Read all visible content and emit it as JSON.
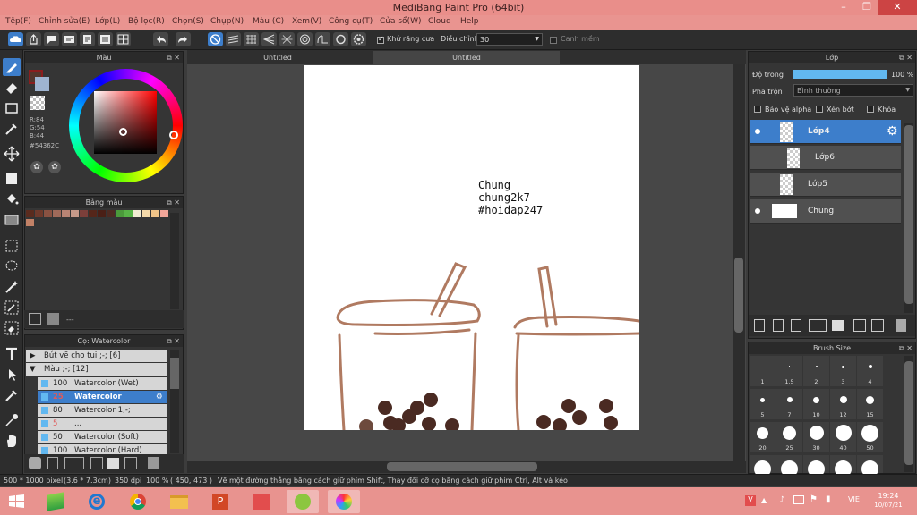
{
  "window": {
    "title": "MediBang Paint Pro (64bit)"
  },
  "menu": [
    "Tệp(F)",
    "Chỉnh sửa(E)",
    "Lớp(L)",
    "Bộ lọc(R)",
    "Chọn(S)",
    "Chụp(N)",
    "Màu (C)",
    "Xem(V)",
    "Công cụ(T)",
    "Cửa sổ(W)",
    "Cloud",
    "Help"
  ],
  "toolbar": {
    "antialias_label": "Khử răng cưa",
    "antialias_checked": true,
    "correction_label": "Điều chỉnh",
    "correction_value": "30",
    "canvas_label": "Canh mềm"
  },
  "color_panel": {
    "title": "Màu",
    "r": "R:84",
    "g": "G:54",
    "b": "B:44",
    "hex": "#54362C",
    "current_color": "#54362c"
  },
  "swatch_panel": {
    "title": "Bảng màu",
    "colors": [
      "#5a2b1e",
      "#6f3a2c",
      "#8a5242",
      "#a06a5a",
      "#b98474",
      "#c69a8a",
      "#7c3f3a",
      "#55261a",
      "#4a1f16",
      "#4e2a22",
      "#4b9a3b",
      "#58b447",
      "#f2ecd3",
      "#f4d9a9",
      "#f0c488",
      "#f4a79a",
      "#c28166"
    ],
    "count": "---"
  },
  "brush_panel": {
    "title": "Cọ: Watercolor",
    "groups": [
      {
        "label": "Bút vẽ cho tui ;-; [6]"
      },
      {
        "label": "Màu ;-; [12]"
      }
    ],
    "items": [
      {
        "size": "100",
        "name": "Watercolor (Wet)"
      },
      {
        "size": "25",
        "name": "Watercolor"
      },
      {
        "size": "80",
        "name": "Watercolor 1;-;"
      },
      {
        "size": "5",
        "name": "..."
      },
      {
        "size": "50",
        "name": "Watercolor (Soft)"
      },
      {
        "size": "100",
        "name": "Watercolor (Hard)"
      }
    ]
  },
  "documents": {
    "tab1": "Untitled",
    "tab2": "Untitled"
  },
  "canvas_text": {
    "line1": "Chung",
    "line2": "chung2k7",
    "line3": "#hoidap247"
  },
  "layer_panel": {
    "title": "Lớp",
    "opacity_label": "Độ trong",
    "opacity_value": "100 %",
    "opacity_fraction": 1.0,
    "blend_label": "Pha trộn",
    "blend_value": "Bình thường",
    "protect_alpha": "Bảo vệ alpha",
    "clipping": "Xén bớt",
    "lock": "Khóa",
    "layers": [
      {
        "name": "Lớp4"
      },
      {
        "name": "Lớp6"
      },
      {
        "name": "Lớp5"
      },
      {
        "name": "Chung"
      }
    ]
  },
  "brush_size_panel": {
    "title": "Brush Size",
    "sizes": [
      "1",
      "1.5",
      "2",
      "3",
      "4",
      "5",
      "7",
      "10",
      "12",
      "15",
      "20",
      "25",
      "30",
      "40",
      "50"
    ]
  },
  "status": {
    "size": "500 * 1000 pixel",
    "physical": "(3.6 * 7.3cm)",
    "dpi": "350 dpi",
    "zoom": "100 %",
    "coords": "( 450, 473 )",
    "hint": "Vẽ một đường thẳng bằng cách giữ phím Shift, Thay đổi cỡ cọ bằng cách giữ phím Ctrl, Alt và kéo"
  },
  "taskbar": {
    "lang": "VIE",
    "time": "19:24",
    "date": "10/07/21"
  }
}
